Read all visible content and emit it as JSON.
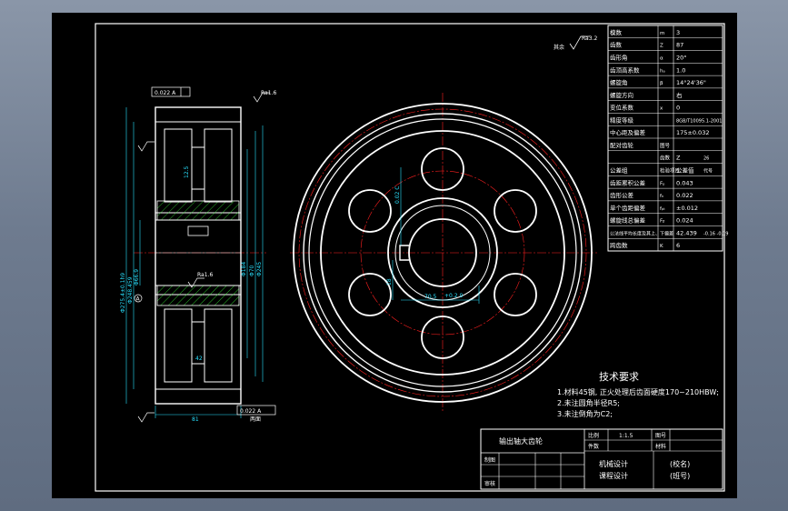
{
  "colors": {
    "background": "#000000",
    "line": "#ffffff",
    "dimension": "#29e1ff",
    "centerline": "#ff2020",
    "hatch": "#39ff39"
  },
  "params": [
    {
      "label": "模数",
      "sym": "m",
      "val": "3"
    },
    {
      "label": "齿数",
      "sym": "Z",
      "val": "87"
    },
    {
      "label": "齿形角",
      "sym": "α",
      "val": "20°"
    },
    {
      "label": "齿顶高系数",
      "sym": "hₐ",
      "val": "1.0"
    },
    {
      "label": "螺旋角",
      "sym": "β",
      "val": "14°24'36\""
    },
    {
      "label": "螺旋方向",
      "sym": "",
      "val": "右"
    },
    {
      "label": "变位系数",
      "sym": "x",
      "val": "0"
    },
    {
      "label": "精度等级",
      "sym": "",
      "val": "8GB/T10095.1-2001"
    },
    {
      "label": "中心距及偏差",
      "sym": "",
      "val": "175±0.032"
    },
    {
      "label": "配对齿轮",
      "sym": "图号",
      "val": ""
    },
    {
      "label": "",
      "sym": "齿数",
      "val": "Z",
      "val2": "26"
    },
    {
      "label": "公差组",
      "sym": "检验项目",
      "val": "公差值",
      "val2": "代号"
    },
    {
      "label": "齿距累积公差",
      "sym": "Fₚ",
      "val": "0.043"
    },
    {
      "label": "齿形公差",
      "sym": "fₙ",
      "val": "0.022"
    },
    {
      "label": "单个齿距偏差",
      "sym": "fₚₜ",
      "val": "±0.012"
    },
    {
      "label": "螺旋线总偏差",
      "sym": "Fᵦ",
      "val": "0.024"
    },
    {
      "label": "公法线平均长度及其上、下偏差",
      "sym": "",
      "val": "42.439",
      "val2": "-0.16 -0.19"
    },
    {
      "label": "跨齿数",
      "sym": "K",
      "val": "6"
    }
  ],
  "dims": {
    "tol_top": "0.022 A",
    "tol_bottom": "0.022 A",
    "tol_key": "0.02 C",
    "d1": "Φ275.4±0.1h9",
    "d2": "Φ248.459",
    "d3": "Φ66.9",
    "d4": "Φ184",
    "d5": "Φ70",
    "d6": "Φ245",
    "width": "81",
    "width_note": "两面",
    "keyway": "70.5",
    "keyway_tol": "+0.2 0",
    "keyway_w": "18",
    "slot": "42",
    "left_note": "12.5",
    "datum": "A",
    "rough": "Ra1.6",
    "rough2": "Ra3.2",
    "other": "其余"
  },
  "tech": {
    "title": "技术要求",
    "items": [
      "1.材料45钢, 正火处理后齿面硬度170~210HBW;",
      "2.未注圆角半径R5;",
      "3.未注倒角为C2;"
    ]
  },
  "titleblock": {
    "part": "输出轴大齿轮",
    "ratio_label": "比例",
    "ratio": "1:1.5",
    "drawno_label": "图号",
    "count_label": "件数",
    "material_label": "材料",
    "draw_label": "制图",
    "check_label": "审核",
    "course": "机械设计",
    "project": "课程设计",
    "school": "(校名)",
    "class": "(班号)"
  }
}
